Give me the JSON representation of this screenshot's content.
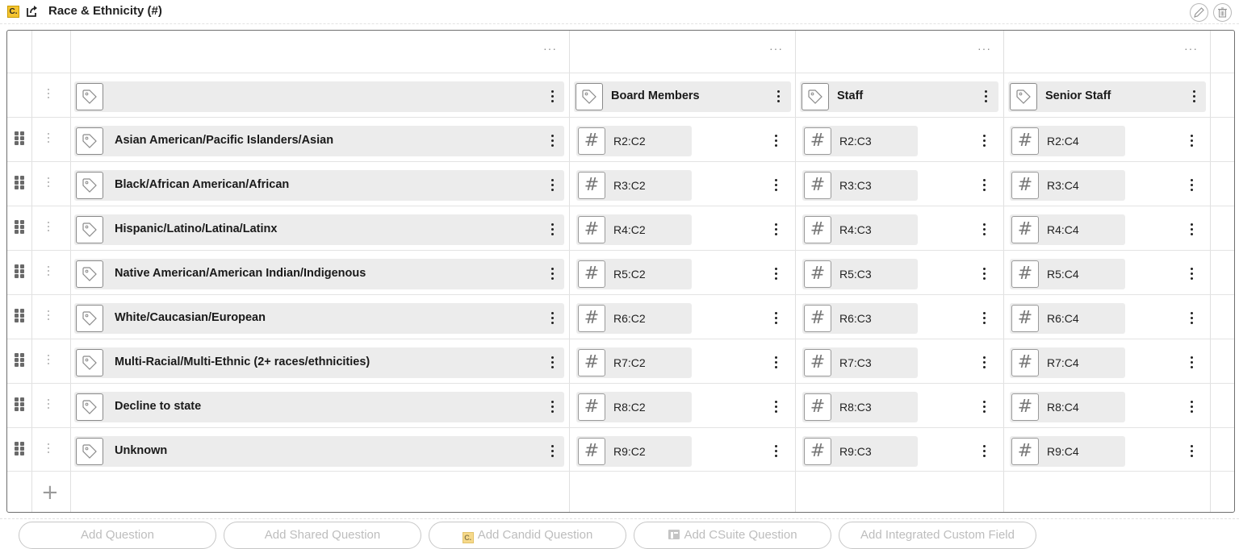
{
  "header": {
    "badge": "C.",
    "title": "Race & Ethnicity (#)"
  },
  "column_menu_glyph": "···",
  "columns": [
    {
      "label": ""
    },
    {
      "label": "Board Members"
    },
    {
      "label": "Staff"
    },
    {
      "label": "Senior Staff"
    }
  ],
  "rows": [
    {
      "label": "Asian American/Pacific Islanders/Asian",
      "cells": [
        "R2:C2",
        "R2:C3",
        "R2:C4"
      ]
    },
    {
      "label": "Black/African American/African",
      "cells": [
        "R3:C2",
        "R3:C3",
        "R3:C4"
      ]
    },
    {
      "label": "Hispanic/Latino/Latina/Latinx",
      "cells": [
        "R4:C2",
        "R4:C3",
        "R4:C4"
      ]
    },
    {
      "label": "Native American/American Indian/Indigenous",
      "cells": [
        "R5:C2",
        "R5:C3",
        "R5:C4"
      ]
    },
    {
      "label": "White/Caucasian/European",
      "cells": [
        "R6:C2",
        "R6:C3",
        "R6:C4"
      ]
    },
    {
      "label": "Multi-Racial/Multi-Ethnic (2+ races/ethnicities)",
      "cells": [
        "R7:C2",
        "R7:C3",
        "R7:C4"
      ]
    },
    {
      "label": "Decline to state",
      "cells": [
        "R8:C2",
        "R8:C3",
        "R8:C4"
      ]
    },
    {
      "label": "Unknown",
      "cells": [
        "R9:C2",
        "R9:C3",
        "R9:C4"
      ]
    }
  ],
  "add_row_glyph": "+",
  "hash_glyph": "#",
  "buttons": {
    "add_question": "Add Question",
    "add_shared_question": "Add Shared Question",
    "add_candid_question": "Add Candid Question",
    "candid_badge": "C.",
    "add_csuite_question": "Add CSuite Question",
    "add_integrated_custom_field": "Add Integrated Custom Field"
  },
  "icons": {
    "badge": "candid-badge-icon",
    "share": "share-icon",
    "edit": "pencil-icon",
    "delete": "trash-icon",
    "tag": "tag-icon",
    "number": "hash-icon",
    "drag": "drag-handle-icon",
    "menu": "kebab-menu-icon"
  },
  "colors": {
    "badge": "#f4c430",
    "field_bg": "#ececec",
    "border": "#6f6f6f"
  }
}
